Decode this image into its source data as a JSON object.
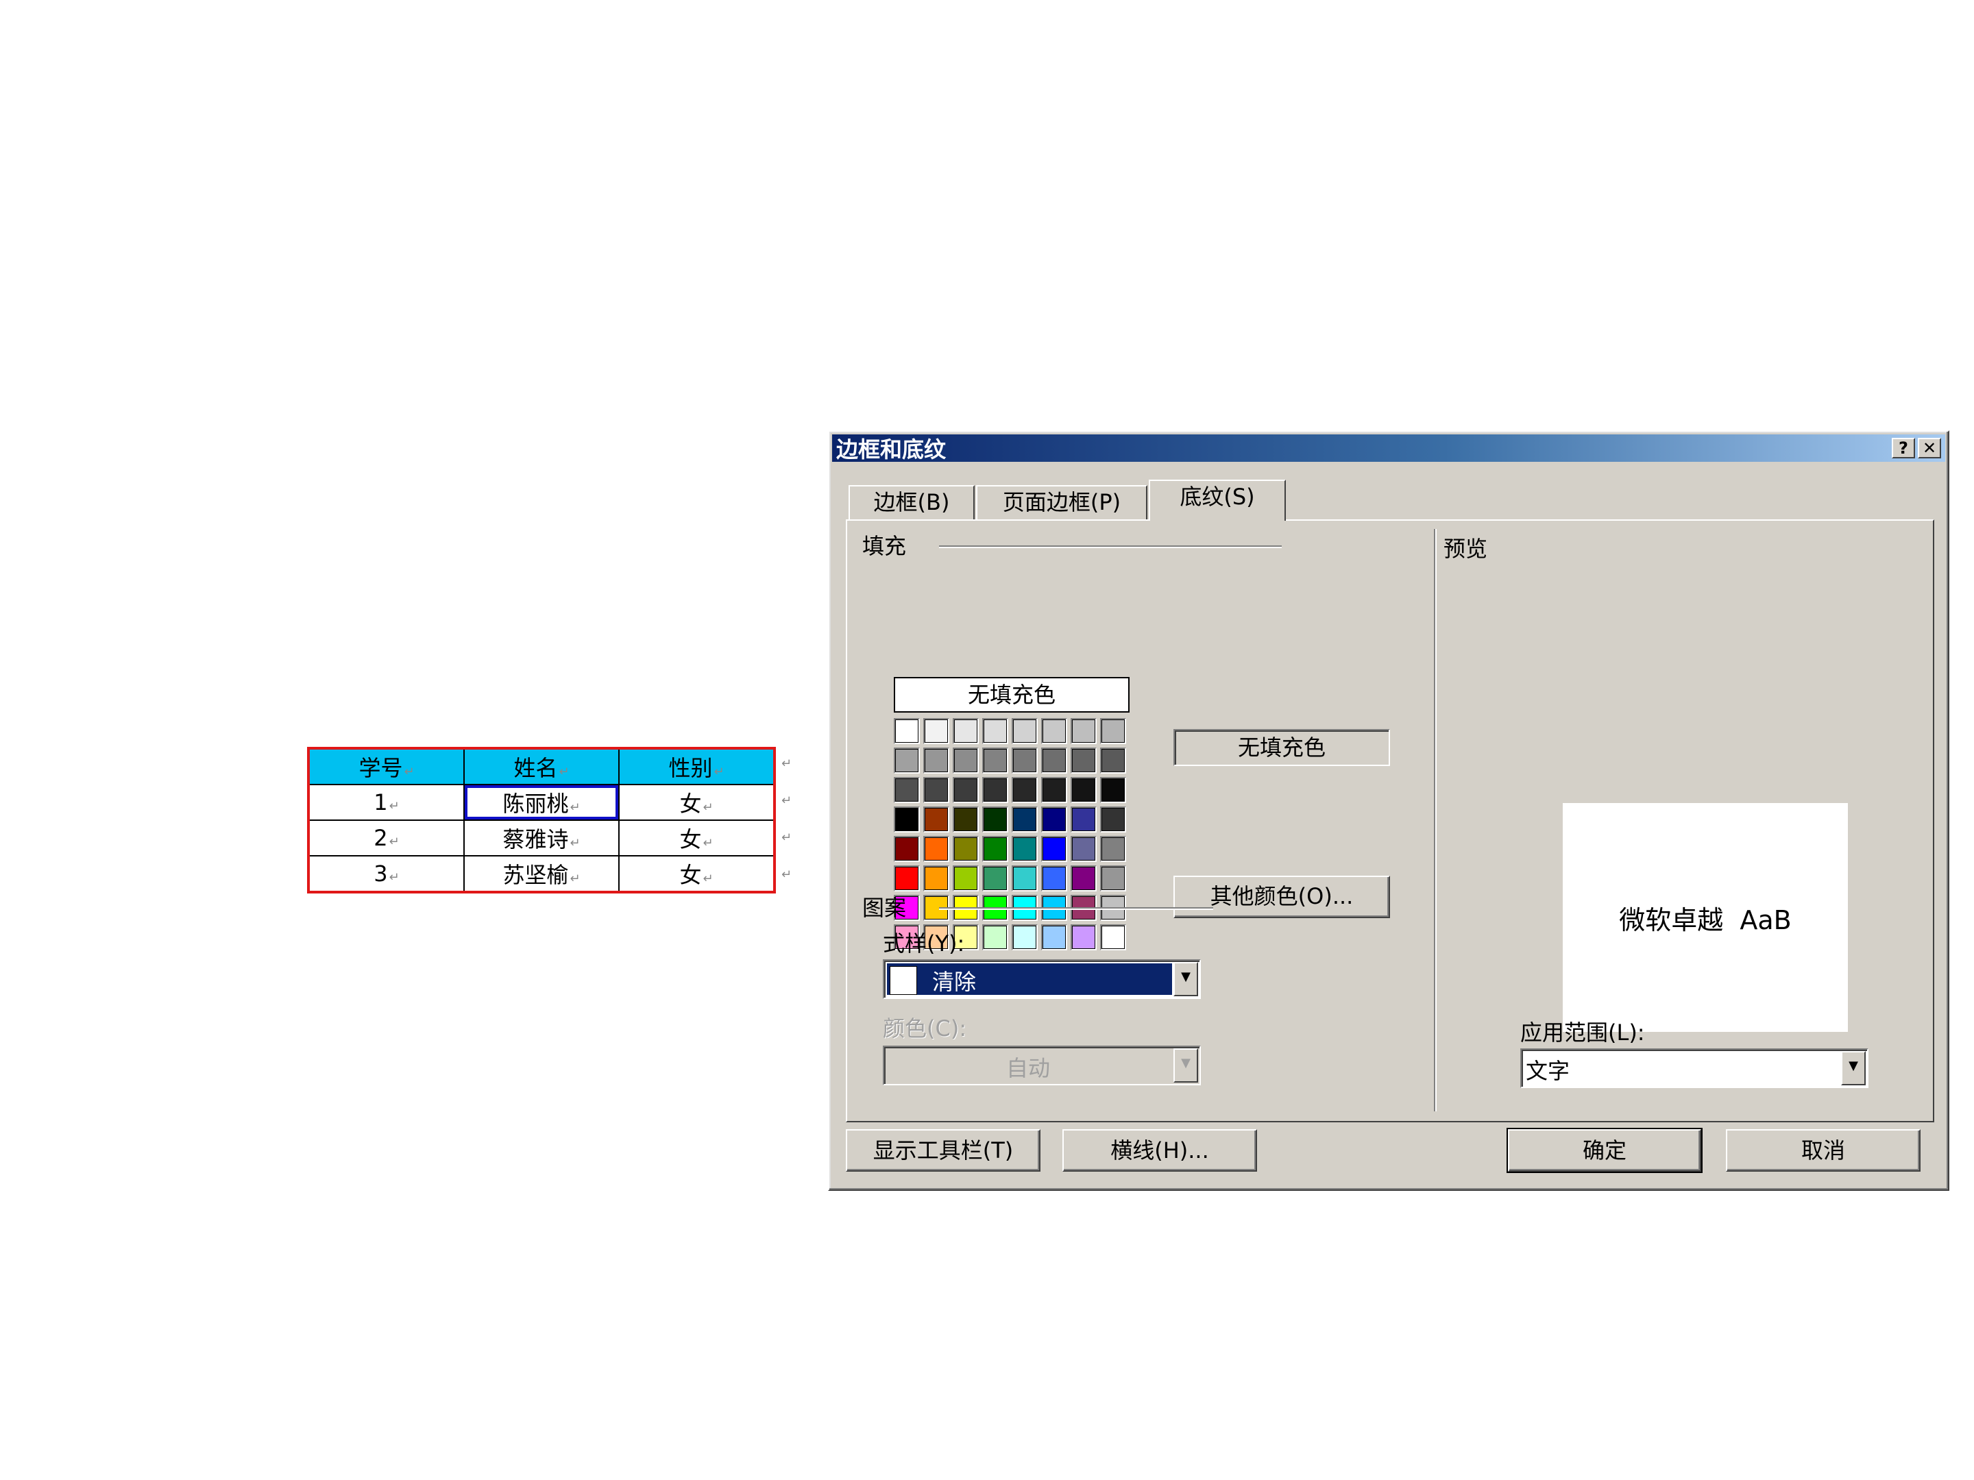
{
  "document": {
    "table": {
      "headers": [
        "学号",
        "姓名",
        "性别"
      ],
      "rows": [
        [
          "1",
          "陈丽桃",
          "女"
        ],
        [
          "2",
          "蔡雅诗",
          "女"
        ],
        [
          "3",
          "苏坚榆",
          "女"
        ]
      ],
      "colors": {
        "header_fill": "#00c0f0",
        "outer_border": "#e01818",
        "selection": "#1010c8"
      }
    },
    "paragraph_mark": "↵"
  },
  "dialog": {
    "title": "边框和底纹",
    "help_button": "?",
    "close_button": "✕",
    "tabs": [
      {
        "label": "边框(B)",
        "active": false
      },
      {
        "label": "页面边框(P)",
        "active": false
      },
      {
        "label": "底纹(S)",
        "active": true
      }
    ],
    "fill": {
      "group_label": "填充",
      "no_fill_cell": "无填充色",
      "current_fill": "无填充色",
      "more_colors_button": "其他颜色(O)...",
      "palette": [
        [
          "#ffffff",
          "#f2f2f2",
          "#e6e6e6",
          "#dcdcdc",
          "#d2d2d2",
          "#c8c8c8",
          "#bebebe",
          "#b4b4b4"
        ],
        [
          "#a0a0a0",
          "#969696",
          "#8c8c8c",
          "#828282",
          "#787878",
          "#6e6e6e",
          "#646464",
          "#5a5a5a"
        ],
        [
          "#505050",
          "#464646",
          "#3c3c3c",
          "#323232",
          "#282828",
          "#1e1e1e",
          "#141414",
          "#0a0a0a"
        ],
        [
          "#000000",
          "#993300",
          "#333300",
          "#003300",
          "#003366",
          "#000080",
          "#333399",
          "#333333"
        ],
        [
          "#800000",
          "#ff6600",
          "#808000",
          "#008000",
          "#008080",
          "#0000ff",
          "#666699",
          "#808080"
        ],
        [
          "#ff0000",
          "#ff9900",
          "#99cc00",
          "#339966",
          "#33cccc",
          "#3366ff",
          "#800080",
          "#969696"
        ],
        [
          "#ff00ff",
          "#ffcc00",
          "#ffff00",
          "#00ff00",
          "#00ffff",
          "#00ccff",
          "#993366",
          "#c0c0c0"
        ],
        [
          "#ff99cc",
          "#ffcc99",
          "#ffff99",
          "#ccffcc",
          "#ccffff",
          "#99ccff",
          "#cc99ff",
          "#ffffff"
        ]
      ]
    },
    "pattern": {
      "group_label": "图案",
      "style_label": "式样(Y):",
      "style_value": "清除",
      "color_label": "颜色(C):",
      "color_value": "自动"
    },
    "preview": {
      "group_label": "预览",
      "sample_text": "微软卓越  AaB",
      "apply_to_label": "应用范围(L):",
      "apply_to_value": "文字"
    },
    "buttons": {
      "show_toolbar": "显示工具栏(T)",
      "horizontal_line": "横线(H)...",
      "ok": "确定",
      "cancel": "取消"
    }
  }
}
